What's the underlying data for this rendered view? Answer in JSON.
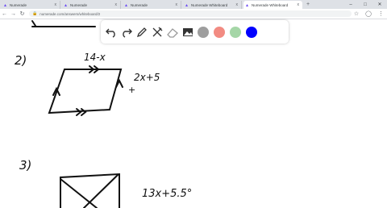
{
  "browser": {
    "tabs": [
      {
        "label": "Numerade"
      },
      {
        "label": "Numerade"
      },
      {
        "label": "Numerade"
      },
      {
        "label": "Numerade Whiteboard"
      },
      {
        "label": "Numerade Whiteboard"
      }
    ],
    "new_tab_glyph": "+",
    "url": "numerade.com/answers/whiteboard/2",
    "back_glyph": "←",
    "forward_glyph": "→",
    "reload_glyph": "↻",
    "lock_glyph": "🔒",
    "star_glyph": "☆",
    "account_glyph": "◯",
    "menu_glyph": "⋮",
    "min_glyph": "–",
    "max_glyph": "□",
    "close_glyph": "✕",
    "tab_close_glyph": "x"
  },
  "toolbar": {
    "tools": [
      "undo-icon",
      "redo-icon",
      "pen-icon",
      "tools-icon",
      "eraser-icon",
      "image-icon"
    ],
    "colors": [
      "#9e9e9e",
      "#f28b82",
      "#a5d6a7",
      "#0000ff"
    ]
  },
  "whiteboard": {
    "problem_2_label": "2)",
    "problem_3_label": "3)",
    "side_top": "14-x",
    "side_right": "2x+5",
    "side_rect": "13x+5.5°",
    "plus_mark": "+",
    "top_fragment": "N/A"
  },
  "colors": {
    "ink": "#111111",
    "tabbar": "#dee1e6",
    "accent": "#1a73e8"
  }
}
